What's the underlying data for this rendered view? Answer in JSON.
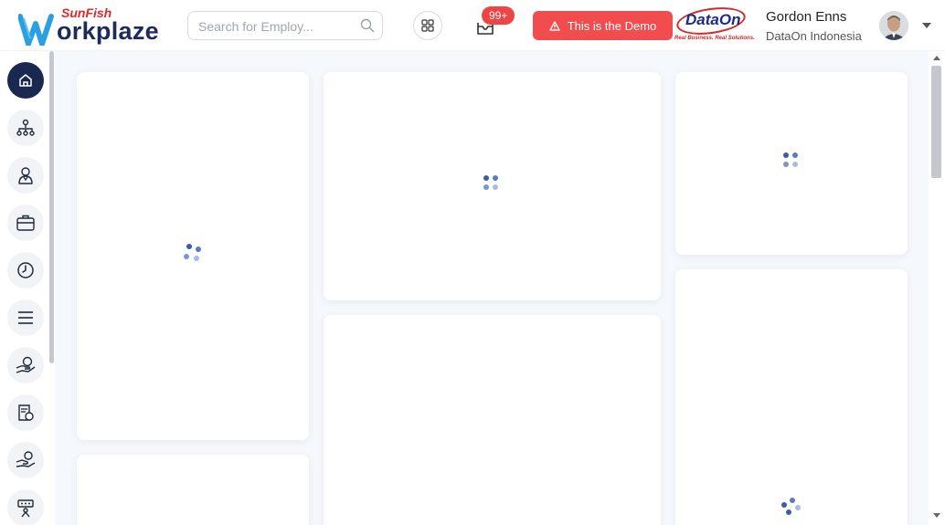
{
  "header": {
    "brand_top": "SunFish",
    "brand_main": "orkplaze",
    "search": {
      "placeholder": "Search for Employ..."
    },
    "notifications_badge": "99+",
    "demo_label": "This is the Demo",
    "partner": {
      "name": "DataOn",
      "tagline": "Real Business. Real Solutions."
    },
    "user": {
      "name": "Gordon Enns",
      "org": "DataOn Indonesia"
    }
  },
  "sidebar": {
    "items": [
      {
        "icon": "home-icon",
        "active": true
      },
      {
        "icon": "org-chart-icon"
      },
      {
        "icon": "employee-icon"
      },
      {
        "icon": "briefcase-icon"
      },
      {
        "icon": "clock-icon"
      },
      {
        "icon": "menu-icon"
      },
      {
        "icon": "hand-money-icon"
      },
      {
        "icon": "payroll-icon"
      },
      {
        "icon": "benefit-icon"
      },
      {
        "icon": "training-icon"
      }
    ]
  },
  "colors": {
    "accent": "#f14d4f",
    "nav_active": "#18284f",
    "brand_navy": "#1e2a5a",
    "spinner": "#3a5bb0"
  }
}
